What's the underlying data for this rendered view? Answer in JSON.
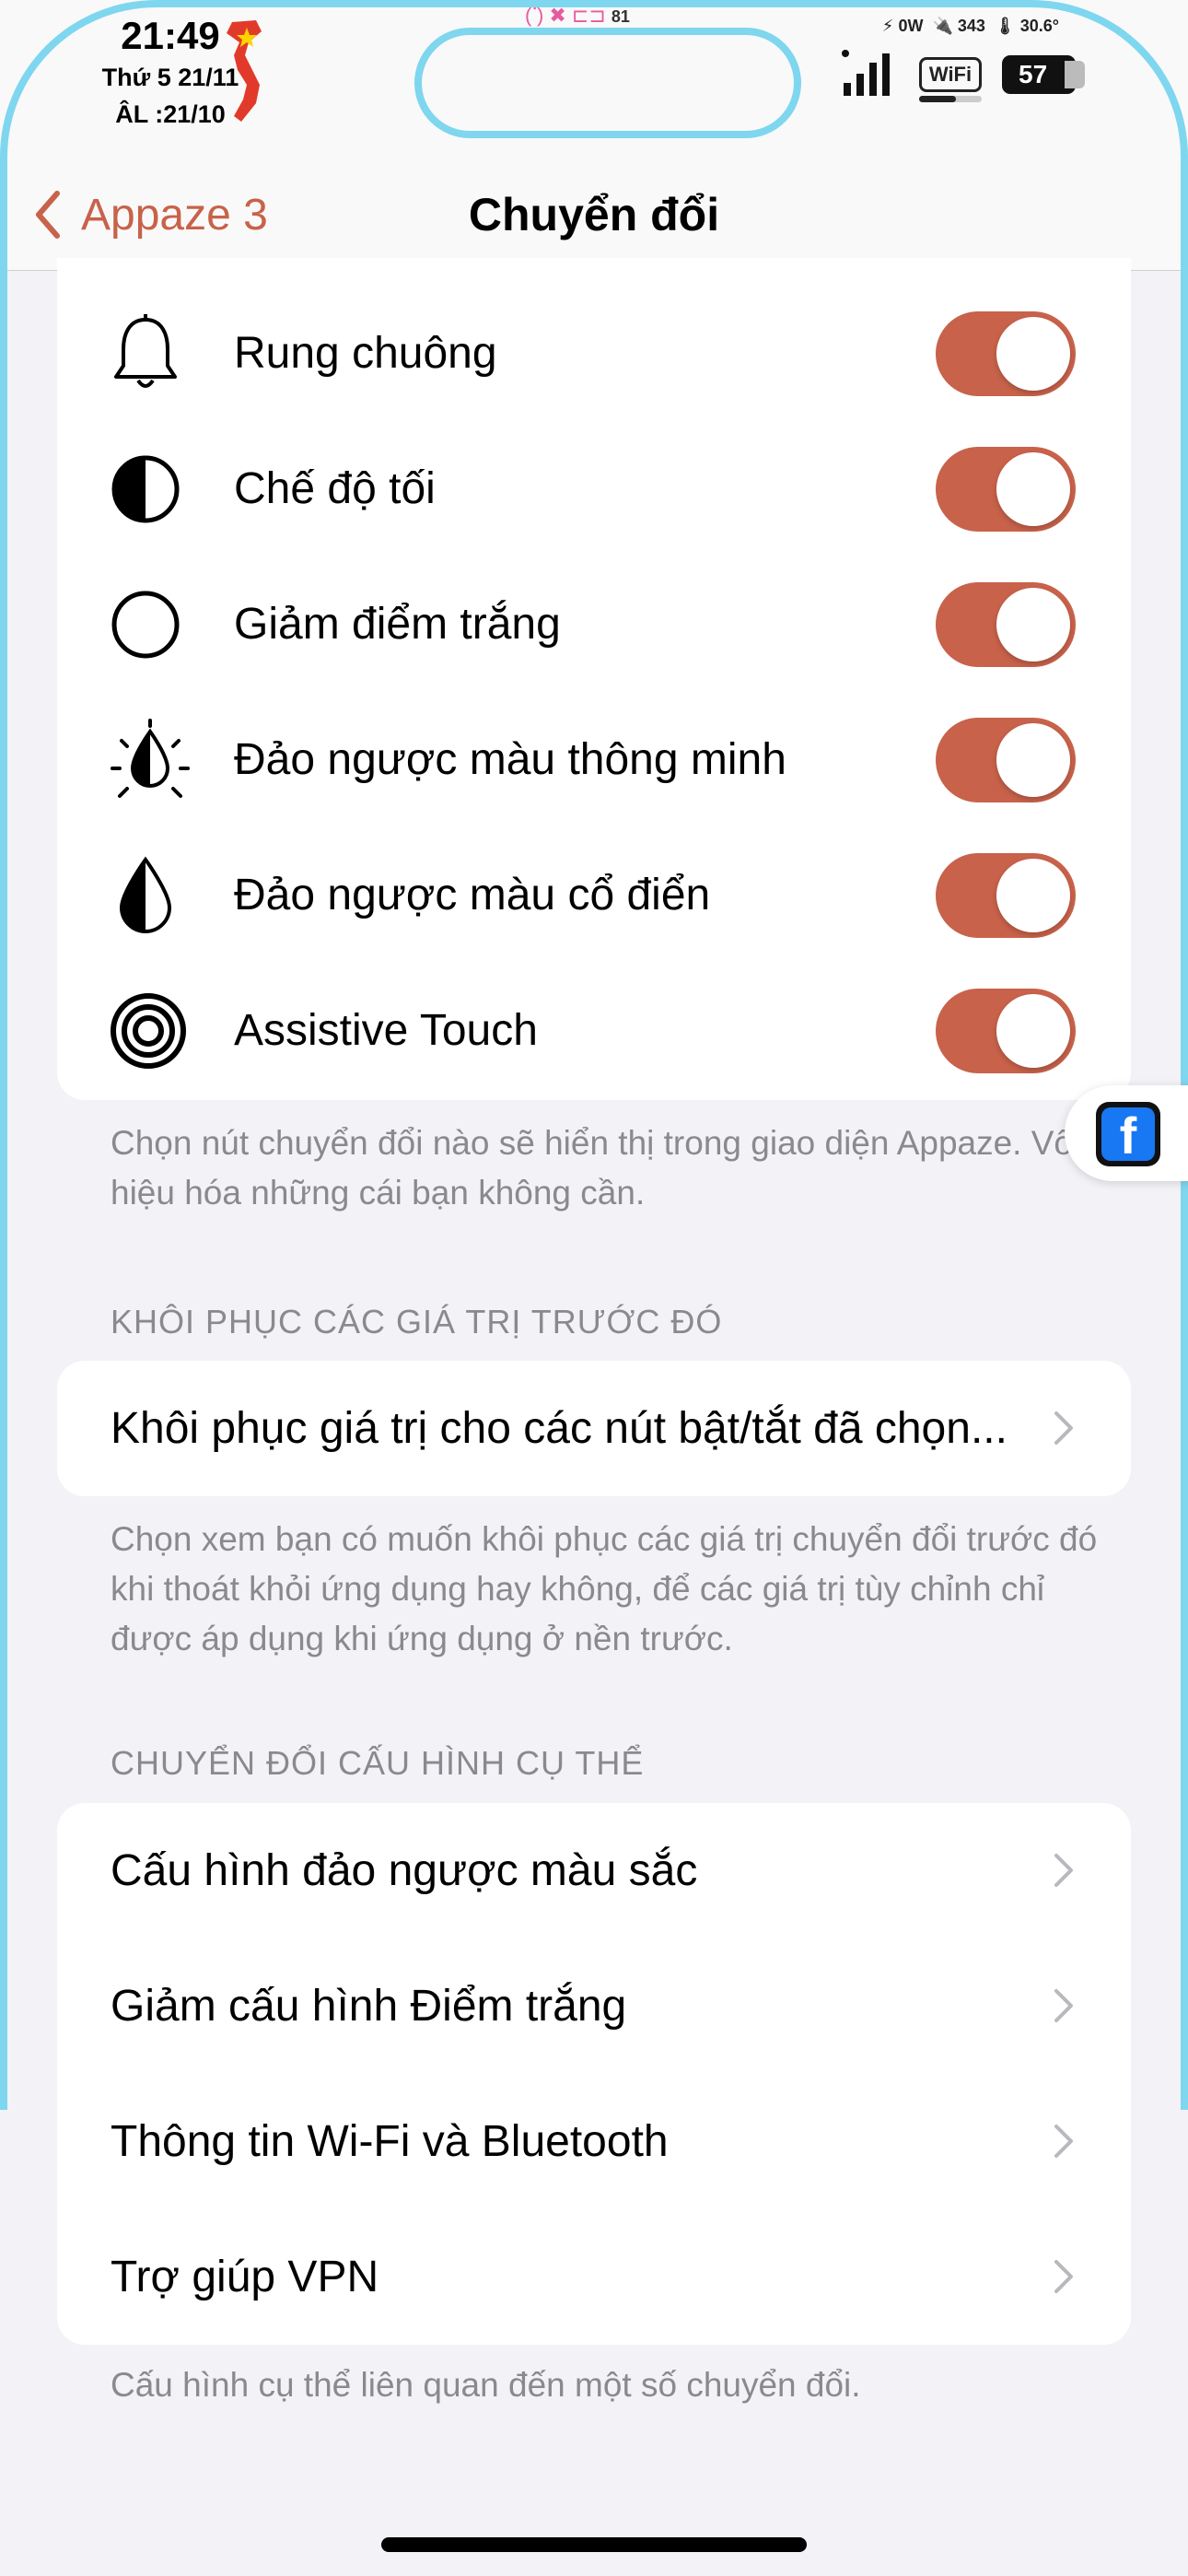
{
  "status_bar": {
    "time": "21:49",
    "date_line": "Thứ 5 21/11",
    "lunar_line": "ÂL :21/10",
    "power": "0W",
    "count": "343",
    "temperature": "30.6°",
    "small_number": "81",
    "wifi_label": "WiFi",
    "battery": "57"
  },
  "nav": {
    "back_label": "Appaze 3",
    "title": "Chuyển đổi"
  },
  "toggles": [
    {
      "icon": "bell-icon",
      "label": "Rung chuông",
      "on": true
    },
    {
      "icon": "dark-mode-icon",
      "label": "Chế độ tối",
      "on": true
    },
    {
      "icon": "circle-outline-icon",
      "label": "Giảm điểm trắng",
      "on": true
    },
    {
      "icon": "smart-invert-icon",
      "label": "Đảo ngược màu thông minh",
      "on": true
    },
    {
      "icon": "drop-half-icon",
      "label": "Đảo ngược màu cổ điển",
      "on": true
    },
    {
      "icon": "assistive-touch-icon",
      "label": "Assistive Touch",
      "on": true
    }
  ],
  "toggles_footnote": "Chọn nút chuyển đổi nào sẽ hiển thị trong giao diện Appaze. Vô hiệu hóa những cái bạn không cần.",
  "restore_section": {
    "header": "KHÔI PHỤC CÁC GIÁ TRỊ TRƯỚC ĐÓ",
    "item": "Khôi phục giá trị cho các nút bật/tắt đã chọn...",
    "footnote": "Chọn xem bạn có muốn khôi phục các giá trị chuyển đổi trước đó khi thoát khỏi ứng dụng hay không, để các giá trị tùy chỉnh chỉ được áp dụng khi ứng dụng ở nền trước."
  },
  "config_section": {
    "header": "CHUYỂN ĐỔI CẤU HÌNH CỤ THỂ",
    "items": [
      "Cấu hình đảo ngược màu sắc",
      "Giảm cấu hình Điểm trắng",
      "Thông tin Wi-Fi và Bluetooth",
      "Trợ giúp VPN"
    ],
    "footnote": "Cấu hình cụ thể liên quan đến một số chuyển đổi."
  },
  "floating_button": {
    "icon": "facebook-icon",
    "glyph": "f"
  },
  "colors": {
    "accent": "#c8624a",
    "background": "#f2f2f7",
    "secondary_text": "#8a8a8e",
    "border": "#7fd6ef"
  }
}
